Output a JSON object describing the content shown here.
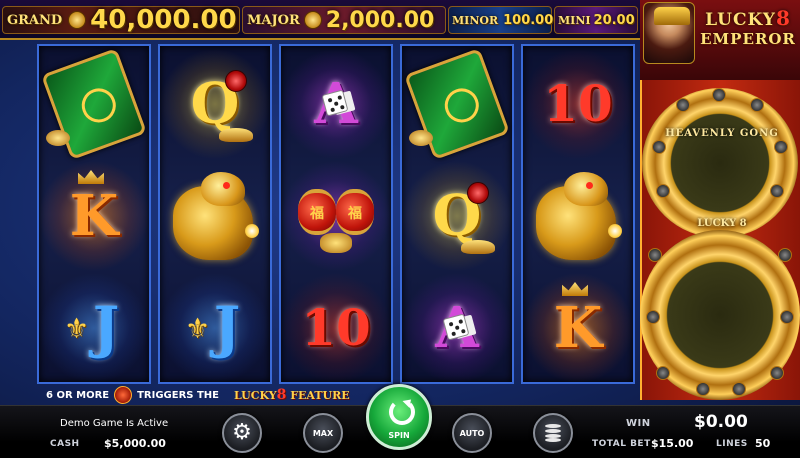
{
  "jackpots": [
    {
      "label": "GRAND",
      "value": "40,000.00"
    },
    {
      "label": "MAJOR",
      "value": "2,000.00"
    },
    {
      "label": "MINOR",
      "value": "100.00"
    },
    {
      "label": "MINI",
      "value": "20.00"
    }
  ],
  "logo": {
    "line1": "LUCKY",
    "eight": "8",
    "line2": "EMPEROR"
  },
  "side_panel": {
    "top_label": "HEAVENLY GONG",
    "bottom_label": "LUCKY 8"
  },
  "reels": [
    [
      {
        "symbol": "jade-card",
        "text": ""
      },
      {
        "symbol": "K",
        "text": "K"
      },
      {
        "symbol": "J",
        "text": "J"
      }
    ],
    [
      {
        "symbol": "Q",
        "text": "Q"
      },
      {
        "symbol": "dragon",
        "text": ""
      },
      {
        "symbol": "J",
        "text": "J"
      }
    ],
    [
      {
        "symbol": "A",
        "text": "A"
      },
      {
        "symbol": "lanterns",
        "text": ""
      },
      {
        "symbol": "10",
        "text": "10"
      }
    ],
    [
      {
        "symbol": "jade-card",
        "text": ""
      },
      {
        "symbol": "Q",
        "text": "Q"
      },
      {
        "symbol": "A",
        "text": "A"
      }
    ],
    [
      {
        "symbol": "10",
        "text": "10"
      },
      {
        "symbol": "dragon",
        "text": ""
      },
      {
        "symbol": "K",
        "text": "K"
      }
    ]
  ],
  "banner": {
    "part1": "6 OR MORE",
    "part2": "TRIGGERS THE",
    "lucky": "LUCKY",
    "eight": "8",
    "feature": "FEATURE"
  },
  "bottom": {
    "status": "Demo Game Is Active",
    "cash_label": "CASH",
    "cash_value": "$5,000.00",
    "win_label": "WIN",
    "win_value": "$0.00",
    "total_bet_label": "TOTAL BET",
    "total_bet_value": "$15.00",
    "lines_label": "LINES",
    "lines_value": "50",
    "max_label": "MAX",
    "spin_label": "SPIN",
    "auto_label": "AUTO"
  },
  "icons": {
    "settings": "gear-icon",
    "spin": "spin-arrow-icon",
    "coins": "coin-stack-icon"
  }
}
